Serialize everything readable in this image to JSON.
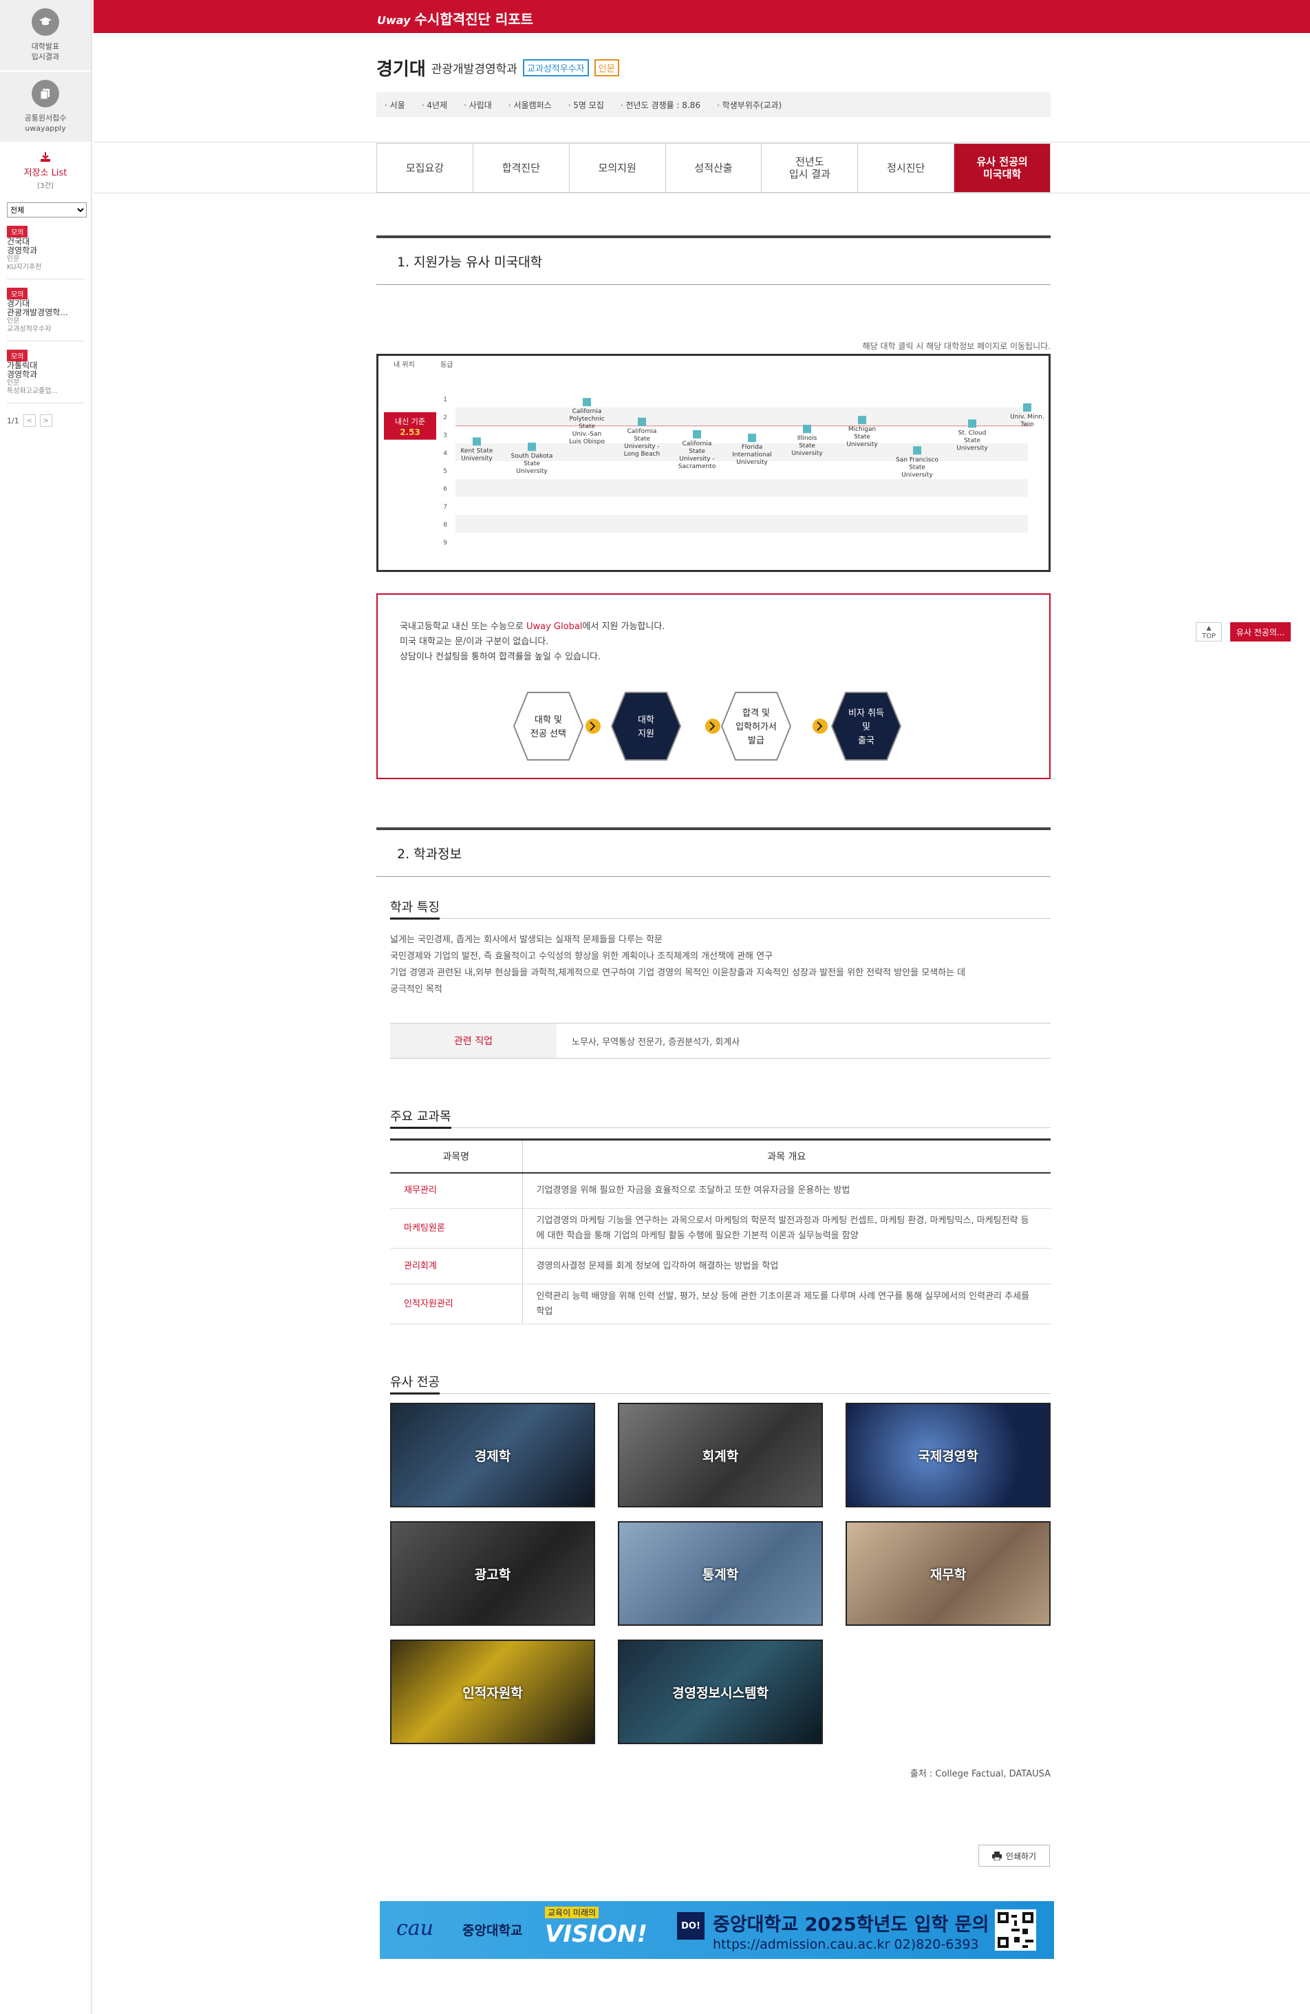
{
  "sidebar": {
    "results_line1": "대학발표",
    "results_line2": "입시결과",
    "apply_line1": "공통원서접수",
    "apply_line2": "uwayapply",
    "list_title": "저장소 List",
    "list_count": "[3건]",
    "select_value": "전체",
    "items": [
      {
        "tag": "모의",
        "name": "건국대",
        "major": "경영학과",
        "extra": "인문",
        "type": "KU자기추천"
      },
      {
        "tag": "모의",
        "name": "경기대",
        "major": "관광개발경영학...",
        "extra": "인문",
        "type": "교과성적우수자"
      },
      {
        "tag": "모의",
        "name": "가톨릭대",
        "major": "경영학과",
        "extra": "인문",
        "type": "특성화고교졸업..."
      }
    ],
    "page": "1/1",
    "prev": "<",
    "next": ">"
  },
  "header": {
    "logo_brand": "Uway",
    "logo_title": "수시합격진단 리포트"
  },
  "school": {
    "name": "경기대",
    "department": "관광개발경영학과",
    "badge1": "교과성적우수자",
    "badge2": "인문",
    "info": [
      "· 서울",
      "· 4년제",
      "· 사립대",
      "· 서울캠퍼스",
      "· 5명 모집",
      "· 전년도 경쟁률 : 8.86",
      "· 학생부위주(교과)"
    ]
  },
  "tabs": [
    "모집요강",
    "합격진단",
    "모의지원",
    "성적산출",
    "전년도\n입시 결과",
    "정시진단",
    "유사 전공의\n미국대학"
  ],
  "section1": {
    "title": "1. 지원가능 유사 미국대학",
    "note": "해당 대학 클릭 시 해당 대학정보 페이지로 이동됩니다."
  },
  "chart_data": {
    "type": "scatter",
    "ylabel": "등급",
    "legend_top_left": "내 위치",
    "my_position_label": "내신 기준",
    "my_position_value": "2.53",
    "my_grade": 2.53,
    "y_ticks": [
      "1",
      "2",
      "3",
      "4",
      "5",
      "6",
      "7",
      "8",
      "9"
    ],
    "points": [
      {
        "name": "Kent State University",
        "grade": 3.4
      },
      {
        "name": "South Dakota State University",
        "grade": 3.7
      },
      {
        "name": "California Polytechnic State Univ.-San Luis Obispo",
        "grade": 1.2
      },
      {
        "name": "California State University - Long Beach",
        "grade": 2.3
      },
      {
        "name": "California State University - Sacramento",
        "grade": 3.0
      },
      {
        "name": "Florida International University",
        "grade": 3.2
      },
      {
        "name": "Illinois State University",
        "grade": 2.7
      },
      {
        "name": "Michigan State University",
        "grade": 2.2
      },
      {
        "name": "San Francisco State University",
        "grade": 3.9
      },
      {
        "name": "St. Cloud State University",
        "grade": 2.4
      },
      {
        "name": "Univ. Minn. Twin",
        "grade": 1.5
      }
    ]
  },
  "promo": {
    "line1_pre": "국내고등학교 내신 또는 수능으로 ",
    "line1_brand": "Uway Global",
    "line1_post": "에서 지원 가능합니다.",
    "line2": "미국 대학교는 문/이과 구분이 없습니다.",
    "line3": "상담이나 컨설팅을 통하여 합격률을 높일 수 있습니다.",
    "steps": [
      "대학 및\n전공 선택",
      "대학\n지원",
      "합격 및\n입학허가서\n발급",
      "비자 취득\n및\n출국"
    ]
  },
  "section2": {
    "title": "2. 학과정보",
    "feature_title": "학과 특징",
    "desc": [
      "넓게는 국민경제, 좁게는 회사에서 발생되는 실재적 문제들을 다루는 학문",
      "국민경제와 기업의 발전, 즉 효율적이고 수익성의 향상을 위한 계획이나 조직체계의 개선책에 관해 연구",
      "기업 경영과 관련된 내,외부 현상들을 과학적,체계적으로 연구하여 기업 경영의 목적인 이윤창출과 지속적인 성장과 발전을 위한 전략적 방안을 모색하는 데",
      "궁극적인 목적"
    ],
    "jobs_label": "관련 직업",
    "jobs_value": "노무사, 무역통상 전문가, 증권분석가, 회계사",
    "courses_title": "주요 교과목",
    "course_headers": [
      "과목명",
      "과목 개요"
    ],
    "courses": [
      {
        "name": "재무관리",
        "desc": "기업경영을 위해 필요한 자금을 효율적으로 조달하고 또한 여유자금을 운용하는 방법"
      },
      {
        "name": "마케팅원론",
        "desc": "기업경영의 마케팅 기능을 연구하는 과목으로서 마케팅의 학문적 발전과정과 마케팅 컨셉트, 마케팅 환경, 마케팅믹스, 마케팅전략 등에 대한 학습을 통해 기업의 마케팅 활동 수행에 필요한 기본적 이론과 실무능력을 함양"
      },
      {
        "name": "관리회계",
        "desc": "경영의사결정 문제를 회계 정보에 입각하여 해결하는 방법을 학업"
      },
      {
        "name": "인적자원관리",
        "desc": "인력관리 능력 배양을 위해 인력 선발, 평가, 보상 등에 관한 기초이론과 제도를 다루며 사례 연구를 통해 실무에서의 인력관리 추세를 학업"
      }
    ],
    "similar_title": "유사 전공",
    "similar": [
      "경제학",
      "회계학",
      "국제경영학",
      "광고학",
      "통계학",
      "재무학",
      "인적자원학",
      "경영정보시스템학"
    ],
    "source": "출처 : College Factual, DATAUSA"
  },
  "print_label": "인쇄하기",
  "float": {
    "top": "TOP",
    "label": "유사 전공의..."
  },
  "banner": {
    "univ": "중앙대학교",
    "slogan_top": "교육이 미래의",
    "vision": "VISION!",
    "doi": "DO!",
    "title": "중앙대학교 2025학년도 입학 문의",
    "contact": "https://admission.cau.ac.kr 02)820-6393"
  },
  "colors": {
    "brand": "#c8102e",
    "dark_tab": "#b50d25",
    "point": "#5bb8c3"
  }
}
